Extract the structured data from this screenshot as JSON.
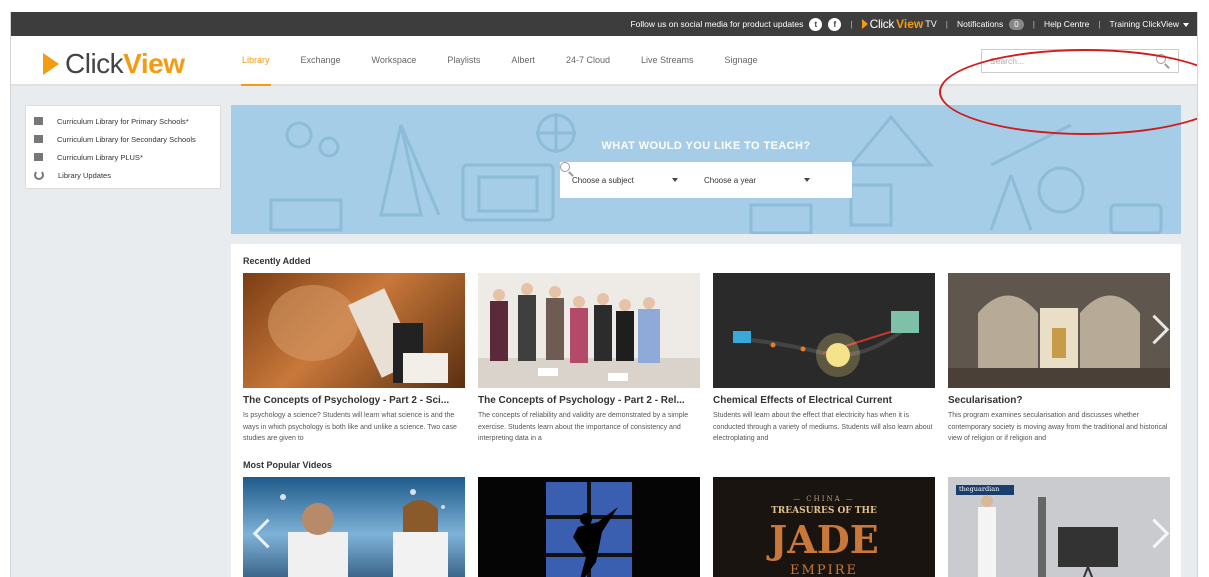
{
  "topbar": {
    "social_text": "Follow us on social media for product updates",
    "twitter_glyph": "t",
    "facebook_glyph": "f",
    "tv_click": "Click",
    "tv_view": "View",
    "tv_suffix": "TV",
    "notifications_label": "Notifications",
    "notifications_count": "0",
    "help_label": "Help Centre",
    "user_label": "Training ClickView"
  },
  "brand": {
    "click": "Click",
    "view": "View"
  },
  "nav": {
    "library": "Library",
    "exchange": "Exchange",
    "workspace": "Workspace",
    "playlists": "Playlists",
    "albert": "Albert",
    "cloud": "24-7 Cloud",
    "live": "Live Streams",
    "signage": "Signage"
  },
  "search": {
    "placeholder": "Search..."
  },
  "sidebar": {
    "items": [
      {
        "label": "Curriculum Library for Primary Schools*"
      },
      {
        "label": "Curriculum Library for Secondary Schools"
      },
      {
        "label": "Curriculum Library PLUS*"
      },
      {
        "label": "Library Updates"
      }
    ]
  },
  "hero": {
    "title": "WHAT WOULD YOU LIKE TO TEACH?",
    "subject_label": "Choose a subject",
    "year_label": "Choose a year"
  },
  "recently_added": {
    "title": "Recently Added",
    "items": [
      {
        "title": "The Concepts of Psychology - Part 2 - Sci...",
        "desc": "Is psychology a science? Students will learn what science is and the ways in which psychology is both like and unlike a science. Two case studies are given to"
      },
      {
        "title": "The Concepts of Psychology - Part 2 - Rel...",
        "desc": "The concepts of reliability and validity are demonstrated by a simple exercise. Students learn about the importance of consistency and interpreting data in a"
      },
      {
        "title": "Chemical Effects of Electrical Current",
        "desc": "Students will learn about the effect that electricity has when it is conducted through a variety of mediums. Students will also learn about electroplating and"
      },
      {
        "title": "Secularisation?",
        "desc": "This program examines secularisation and discusses whether contemporary society is moving away from the traditional and historical view of religion or if religion and"
      }
    ]
  },
  "most_popular": {
    "title": "Most Popular Videos",
    "jade_china": "— CHINA —",
    "jade_treasures": "TREASURES OF THE",
    "jade_word": "JADE",
    "jade_empire": "EMPIRE",
    "guardian_label": "theguardian"
  },
  "colors": {
    "accent": "#f39c12",
    "topbar": "#3d3d3d",
    "hero": "#a5cde8",
    "annotation": "#d21b1b"
  }
}
